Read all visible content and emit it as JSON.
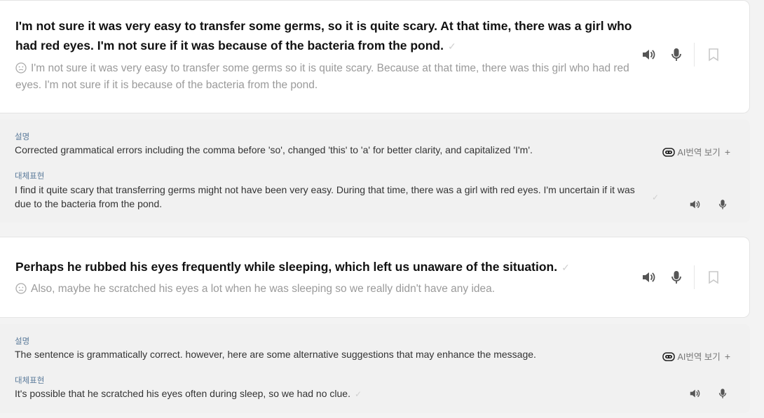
{
  "items": [
    {
      "corrected": "I'm not sure it was very easy to transfer some germs, so it is quite scary. At that time, there was a girl who had red eyes. I'm not sure if it was because of the bacteria from the pond.",
      "original": "I'm not sure it was very easy to transfer some germs so it is quite scary. Because at that time, there was this girl who had red eyes. I'm not sure if it is because of the bacteria from the pond.",
      "explanation_label": "설명",
      "explanation": "Corrected grammatical errors including the comma before 'so', changed 'this' to 'a' for better clarity, and capitalized 'I'm'.",
      "translate_label": "AI번역 보기",
      "alternative_label": "대체표현",
      "alternative": "I find it quite scary that transferring germs might not have been very easy. During that time, there was a girl with red eyes. I'm uncertain if it was due to the bacteria from the pond."
    },
    {
      "corrected": "Perhaps he rubbed his eyes frequently while sleeping, which left us unaware of the situation.",
      "original": "Also, maybe he scratched his eyes a lot when he was sleeping so we really didn't have any idea.",
      "explanation_label": "설명",
      "explanation": "The sentence is grammatically correct. however, here are some alternative suggestions that may enhance the message.",
      "translate_label": "AI번역 보기",
      "alternative_label": "대체표현",
      "alternative": "It's possible that he scratched his eyes often during sleep, so we had no clue."
    }
  ],
  "icons": {
    "check": "check-icon",
    "face": "neutral-face-icon",
    "speaker": "speaker-icon",
    "mic": "microphone-icon",
    "bookmark": "bookmark-icon",
    "ai": "ai-robot-icon"
  },
  "colors": {
    "label": "#5a7a9a",
    "icon": "#555555",
    "muted": "#9a9a9a"
  }
}
